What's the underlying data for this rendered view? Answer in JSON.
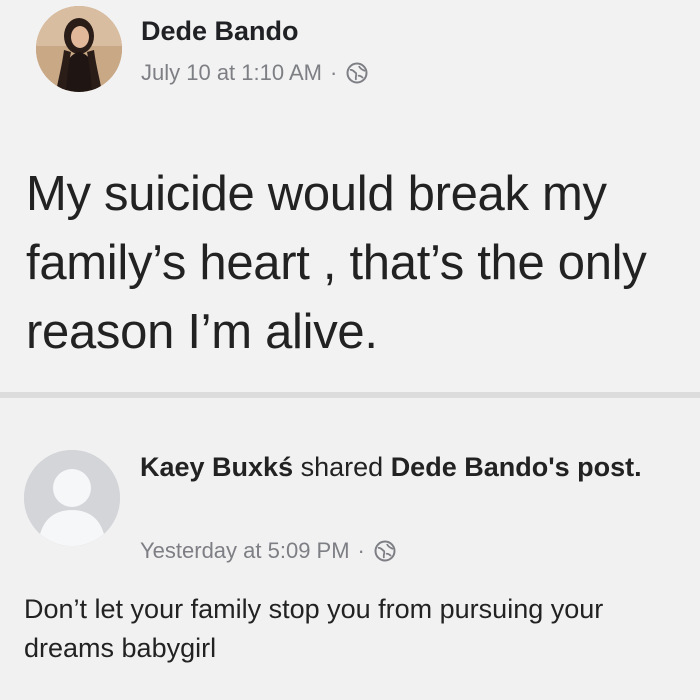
{
  "original_post": {
    "author": "Dede Bando",
    "timestamp": "July 10 at 1:10 AM",
    "separator": "·",
    "privacy_icon": "globe-icon",
    "text": "My suicide would break my family’s heart , that’s the only reason I’m alive."
  },
  "shared_post": {
    "sharer": "Kaey Buxkś",
    "action": "shared",
    "original_author_possessive": "Dede Bando's",
    "object": "post.",
    "timestamp": "Yesterday at 5:09 PM",
    "separator": "·",
    "privacy_icon": "globe-icon",
    "avatar_icon": "default-profile-avatar-icon",
    "text": "Don’t let your family stop you from pursuing your dreams babygirl"
  },
  "colors": {
    "background": "#f2f2f2",
    "divider": "#dcdcdc",
    "meta_text": "#7d7f84",
    "avatar_placeholder": "#d1d3d7"
  }
}
